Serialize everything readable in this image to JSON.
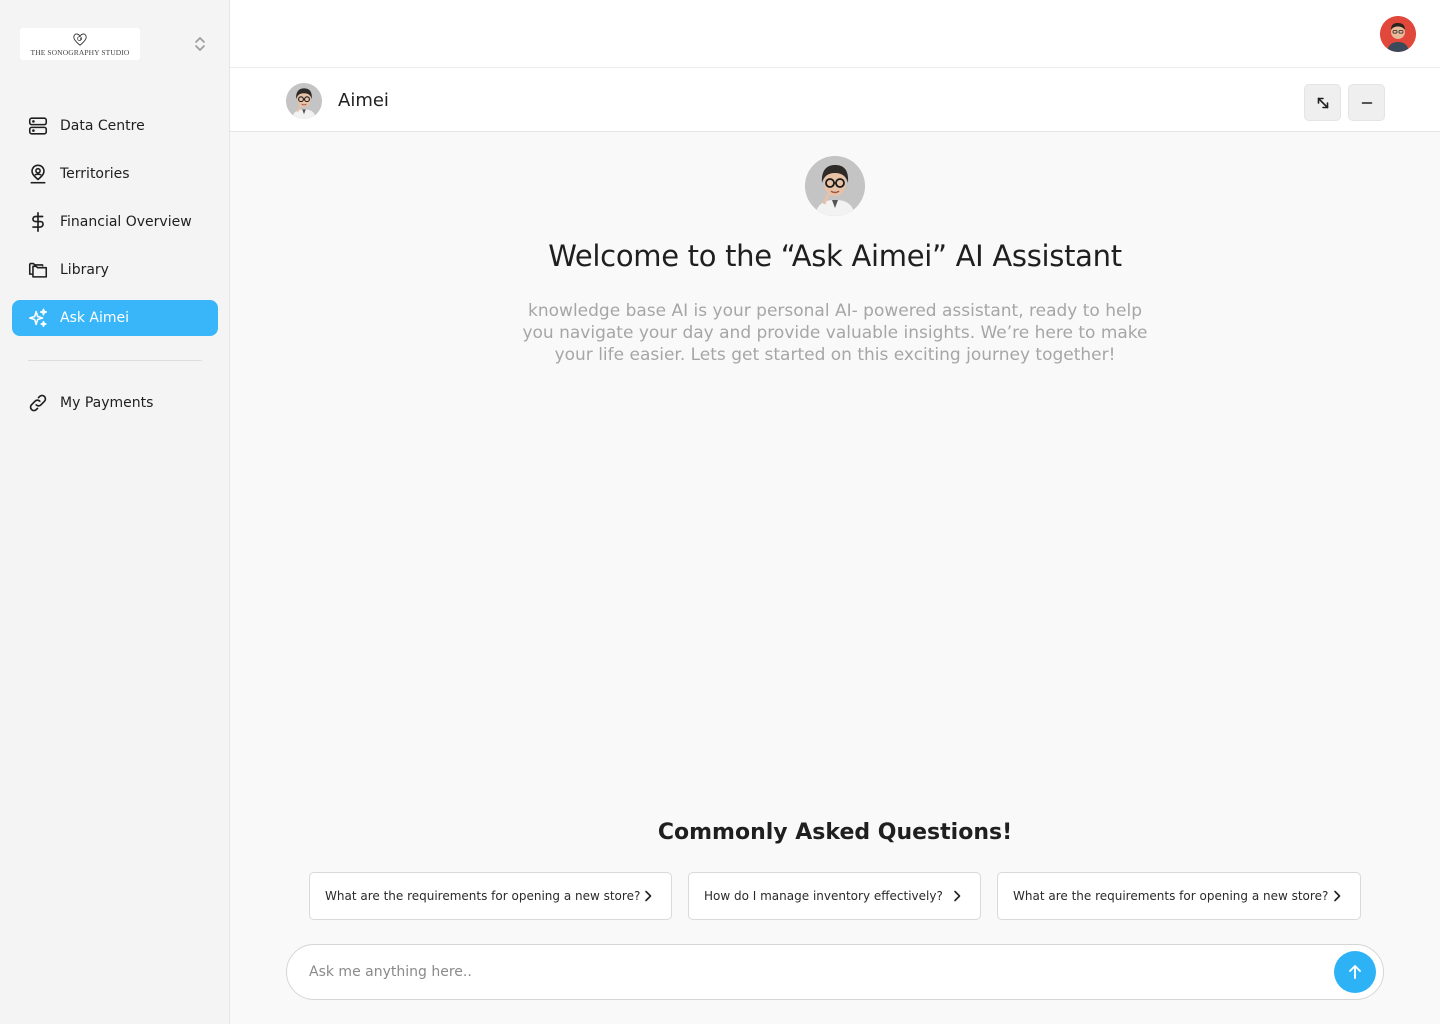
{
  "brand": {
    "logo_text": "THE SONOGRAPHY STUDIO"
  },
  "sidebar": {
    "items": [
      {
        "label": "Data Centre",
        "icon": "server-icon",
        "active": false
      },
      {
        "label": "Territories",
        "icon": "map-pin-user-icon",
        "active": false
      },
      {
        "label": "Financial Overview",
        "icon": "dollar-icon",
        "active": false
      },
      {
        "label": "Library",
        "icon": "folders-icon",
        "active": false
      },
      {
        "label": "Ask Aimei",
        "icon": "sparkles-icon",
        "active": true
      }
    ],
    "secondary": [
      {
        "label": "My Payments",
        "icon": "link-icon"
      }
    ]
  },
  "chat": {
    "bot_name": "Aimei",
    "welcome_title": "Welcome to the “Ask Aimei” AI Assistant",
    "intro": "knowledge base AI is your personal AI- powered assistant, ready to help you navigate your day and provide valuable insights. We’re here to make your life easier. Lets get started on this exciting journey together!",
    "faq_title": "Commonly Asked Questions!",
    "faqs": [
      "What are the requirements for opening a new store?",
      "How do I manage inventory effectively?",
      "What are the requirements for opening a new store?"
    ],
    "input": {
      "placeholder": "Ask me anything here..",
      "value": ""
    }
  },
  "colors": {
    "accent": "#38b6f9",
    "send": "#2db3f5",
    "sidebar_bg": "#f4f4f4",
    "main_bg": "#f9f9f9"
  }
}
